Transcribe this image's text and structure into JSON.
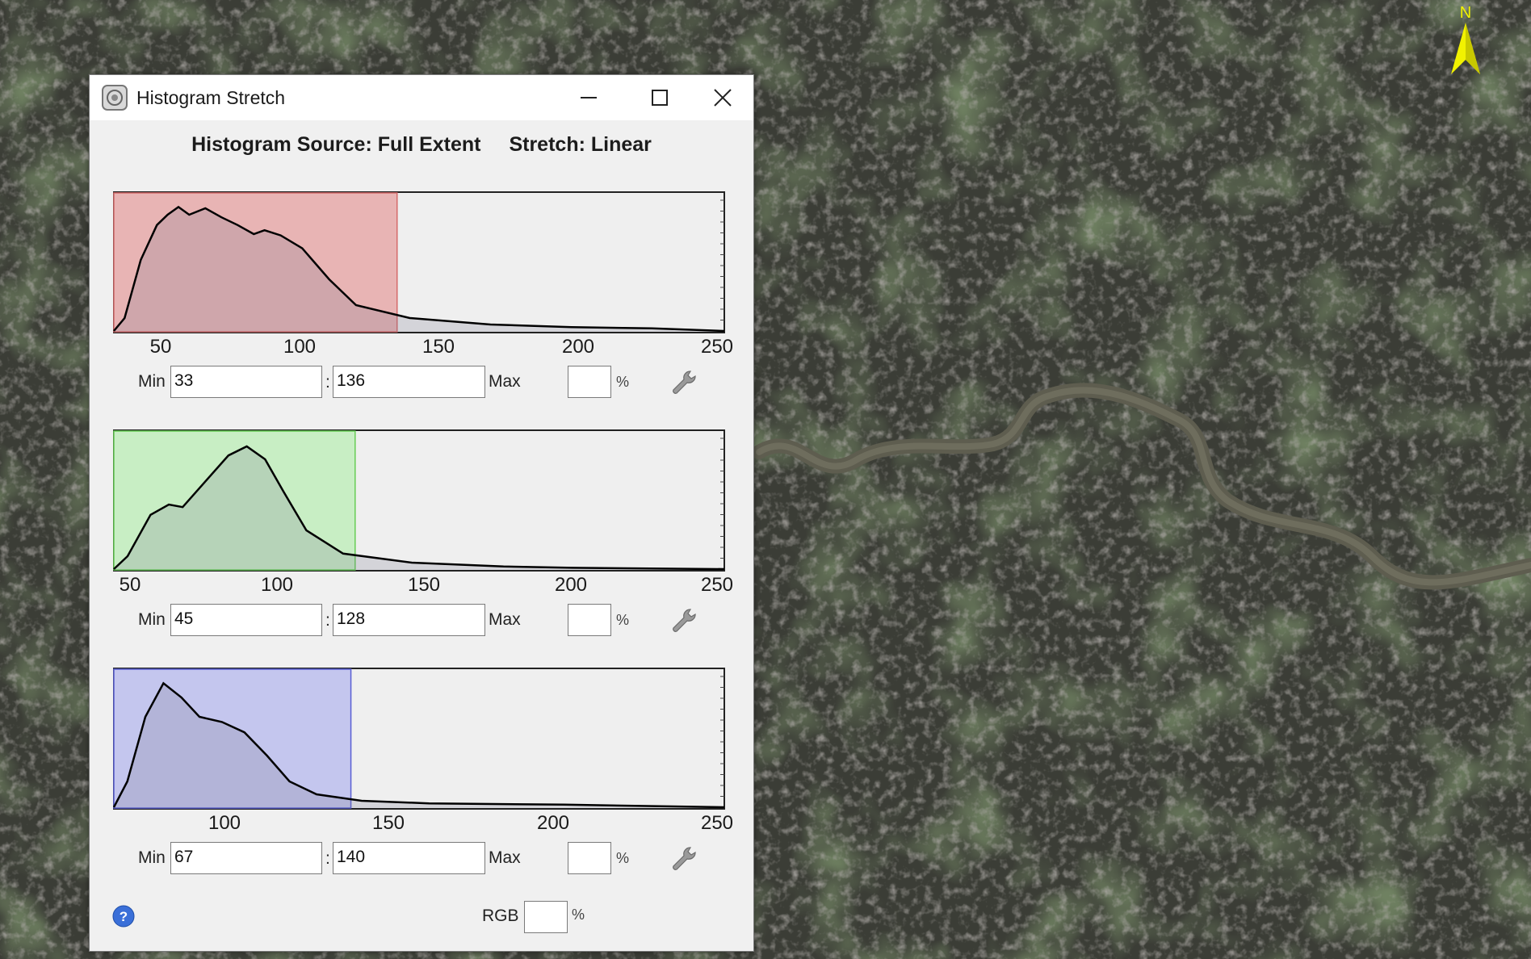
{
  "dialog": {
    "title": "Histogram Stretch",
    "histogram_source": "Histogram Source: Full Extent",
    "stretch": "Stretch: Linear"
  },
  "panels": [
    {
      "channel": "red",
      "color": "#e8b4b4",
      "line_color": "#d46a6a",
      "ticks": [
        "50",
        "100",
        "150",
        "200",
        "250"
      ],
      "axis_range": [
        33,
        255
      ],
      "stretch_min": 33,
      "stretch_max": 136,
      "min_label": "Min",
      "min_value": "33",
      "max_value": "136",
      "max_label": "Max",
      "separator": ":",
      "percent_symbol": "%"
    },
    {
      "channel": "green",
      "color": "#c8eec4",
      "line_color": "#66cc55",
      "ticks": [
        "50",
        "100",
        "150",
        "200",
        "250"
      ],
      "axis_range": [
        45,
        255
      ],
      "stretch_min": 45,
      "stretch_max": 128,
      "min_label": "Min",
      "min_value": "45",
      "max_value": "128",
      "max_label": "Max",
      "separator": ":",
      "percent_symbol": "%"
    },
    {
      "channel": "blue",
      "color": "#c4c6ee",
      "line_color": "#5a5fd4",
      "ticks": [
        "100",
        "150",
        "200",
        "250"
      ],
      "axis_range": [
        67,
        255
      ],
      "stretch_min": 67,
      "stretch_max": 140,
      "min_label": "Min",
      "min_value": "67",
      "max_value": "140",
      "max_label": "Max",
      "separator": ":",
      "percent_symbol": "%"
    }
  ],
  "footer": {
    "rgb_label": "RGB",
    "percent_symbol": "%"
  },
  "map": {
    "north_label": "N"
  },
  "icons": {
    "app": "histogram-app-icon",
    "minimize": "minimize-icon",
    "maximize": "maximize-icon",
    "close": "close-icon",
    "settings": "wrench-icon",
    "help": "help-icon",
    "north": "north-arrow-icon"
  }
}
